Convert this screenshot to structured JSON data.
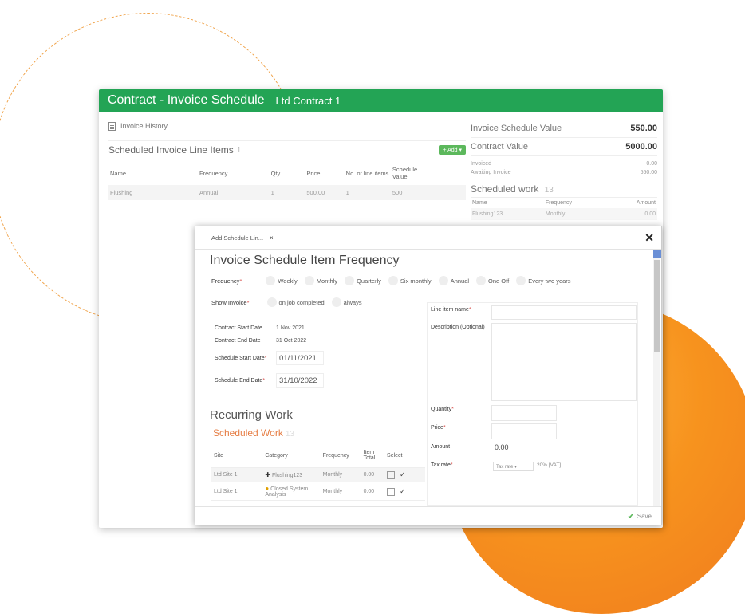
{
  "main": {
    "title": "Contract - Invoice Schedule",
    "subtitle": "Ltd Contract 1",
    "invoice_history": "Invoice History",
    "scheduled_line_items": {
      "label": "Scheduled Invoice Line Items",
      "count": "1",
      "add_button": "+ Add ▾",
      "columns": [
        "Name",
        "Frequency",
        "Qty",
        "Price",
        "No. of line items",
        "Schedule Value"
      ],
      "rows": [
        [
          "Flushing",
          "Annual",
          "1",
          "500.00",
          "1",
          "500"
        ]
      ]
    },
    "summary": {
      "invoice_schedule_value_label": "Invoice Schedule Value",
      "invoice_schedule_value": "550.00",
      "contract_value_label": "Contract Value",
      "contract_value": "5000.00",
      "invoiced_label": "Invoiced",
      "invoiced": "0.00",
      "awaiting_label": "Awaiting Invoice",
      "awaiting": "550.00"
    },
    "scheduled_work": {
      "label": "Scheduled work",
      "count": "13",
      "columns": [
        "Name",
        "Frequency",
        "Amount"
      ],
      "rows": [
        [
          "Flushing123",
          "Monthly",
          "0.00"
        ]
      ]
    }
  },
  "modal": {
    "tab_label": "Add Schedule Lin...",
    "tab_close": "×",
    "close": "✕",
    "heading": "Invoice Schedule Item Frequency",
    "frequency_label": "Frequency",
    "frequency_options": [
      "Weekly",
      "Monthly",
      "Quarterly",
      "Six monthly",
      "Annual",
      "One Off",
      "Every two years"
    ],
    "show_invoice_label": "Show Invoice",
    "show_invoice_options": [
      "on job completed",
      "always"
    ],
    "contract_start_label": "Contract Start Date",
    "contract_start": "1 Nov 2021",
    "contract_end_label": "Contract End Date",
    "contract_end": "31 Oct 2022",
    "schedule_start_label": "Schedule Start Date",
    "schedule_start": "01/11/2021",
    "schedule_end_label": "Schedule End Date",
    "schedule_end": "31/10/2022",
    "recurring_work": "Recurring Work",
    "scheduled_work_label": "Scheduled Work",
    "scheduled_work_count": "13",
    "sw_columns": [
      "Site",
      "Category",
      "Frequency",
      "Item Total",
      "Select"
    ],
    "sw_rows": [
      {
        "site": "Ltd Site 1",
        "category": "Flushing123",
        "frequency": "Monthly",
        "total": "0.00"
      },
      {
        "site": "Ltd Site 1",
        "category": "Closed System Analysis",
        "frequency": "Monthly",
        "total": "0.00"
      }
    ],
    "line_item_name_label": "Line item name",
    "description_label": "Description (Optional)",
    "quantity_label": "Quantity",
    "price_label": "Price",
    "amount_label": "Amount",
    "amount_value": "0.00",
    "tax_rate_label": "Tax rate",
    "tax_rate_select": "Tax rate ▾",
    "tax_rate_value": "20% [VAT]",
    "save_label": "Save"
  }
}
